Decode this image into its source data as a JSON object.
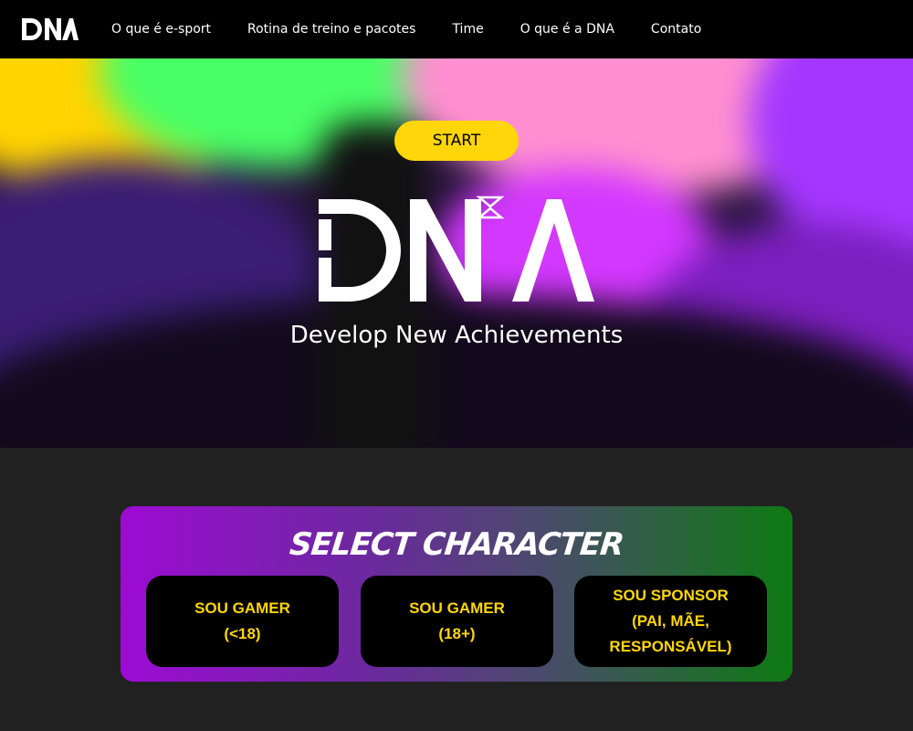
{
  "nav": {
    "logo": "DNA",
    "links": [
      "O que é e-sport",
      "Rotina de treino e pacotes",
      "Time",
      "O que é a DNA",
      "Contato"
    ]
  },
  "hero": {
    "start_label": "START",
    "logo": "DNA",
    "subtitle": "Develop New Achievements"
  },
  "select": {
    "title": "SELECT CHARACTER",
    "cards": [
      "SOU GAMER\n(<18)",
      "SOU GAMER\n(18+)",
      "SOU SPONSOR\n(PAI, MÃE,\nRESPONSÁVEL)"
    ]
  },
  "colors": {
    "accent": "#ffd60a",
    "nav_bg": "#000000",
    "page_bg": "#212121",
    "gradient_start": "#9d0bd4",
    "gradient_end": "#0d7a12"
  }
}
